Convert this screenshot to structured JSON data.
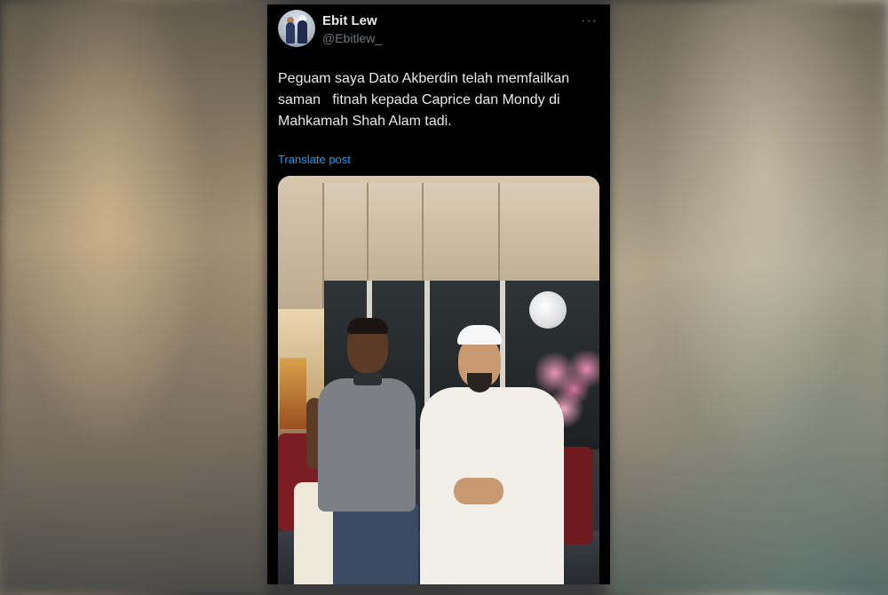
{
  "author": {
    "name": "Ebit Lew",
    "handle": "@Ebitlew_"
  },
  "post": {
    "text": "Peguam saya Dato Akberdin telah memfailkan saman   fitnah kepada Caprice dan Mondy di Mahkamah Shah Alam tadi.",
    "translate_label": "Translate post",
    "more_icon": "more-horizontal-icon"
  },
  "colors": {
    "card_bg": "#000000",
    "text_primary": "#e7e9ea",
    "text_secondary": "#71767b",
    "link": "#1d9bf0"
  }
}
